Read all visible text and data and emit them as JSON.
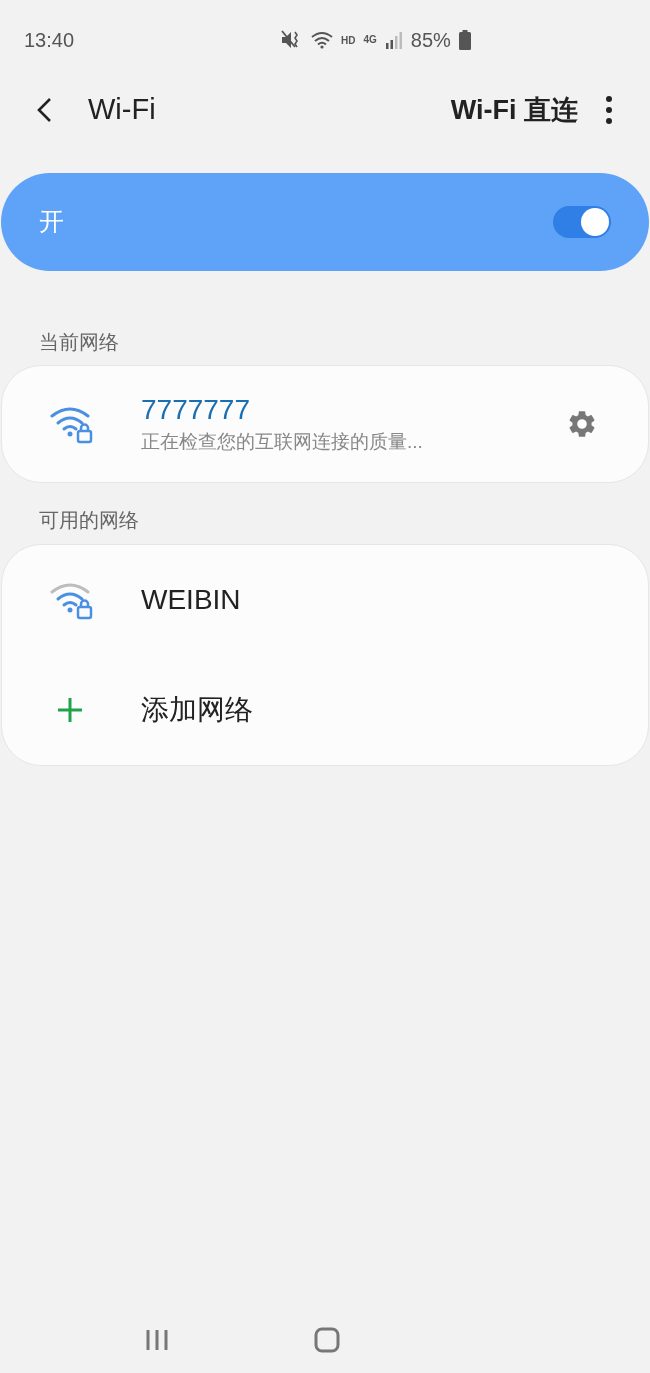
{
  "status_bar": {
    "time": "13:40",
    "hd": "HD",
    "network": "4G",
    "battery": "85%"
  },
  "header": {
    "title": "Wi-Fi",
    "action": "Wi-Fi 直连"
  },
  "master_switch": {
    "label": "开",
    "on": true
  },
  "current_section": {
    "label": "当前网络",
    "networks": [
      {
        "name": "7777777",
        "status": "正在检查您的互联网连接的质量..."
      }
    ]
  },
  "available_section": {
    "label": "可用的网络",
    "networks": [
      {
        "name": "WEIBIN"
      }
    ],
    "add_label": "添加网络"
  }
}
